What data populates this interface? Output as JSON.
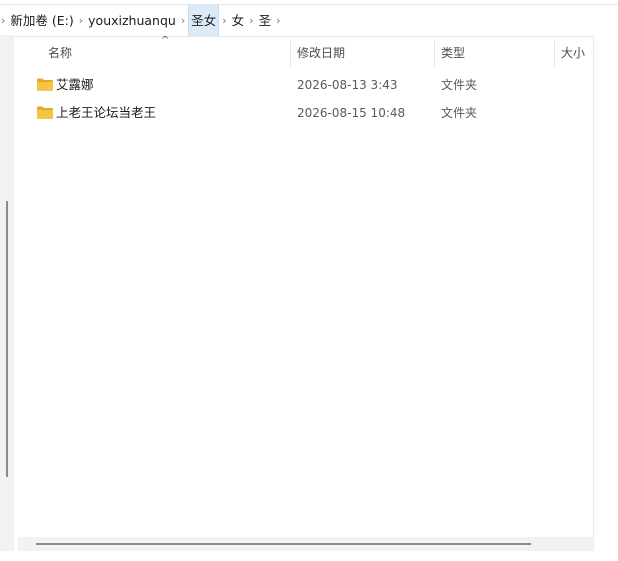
{
  "breadcrumb": {
    "items": [
      {
        "label": "新加卷 (E:)"
      },
      {
        "label": "youxizhuanqu"
      },
      {
        "label": "圣女"
      },
      {
        "label": "女"
      },
      {
        "label": "圣"
      }
    ],
    "separator": "›"
  },
  "columns": {
    "name": "名称",
    "modified": "修改日期",
    "type": "类型",
    "size": "大小",
    "sort_indicator": "^"
  },
  "files": [
    {
      "name": "艾露娜",
      "modified": "2026-08-13 3:43",
      "type": "文件夹"
    },
    {
      "name": "上老王论坛当老王",
      "modified": "2026-08-15 10:48",
      "type": "文件夹"
    }
  ],
  "colors": {
    "folder": "#f4c443",
    "folder_dark": "#e0a92a",
    "breadcrumb_highlight": "#dbeaf8"
  }
}
